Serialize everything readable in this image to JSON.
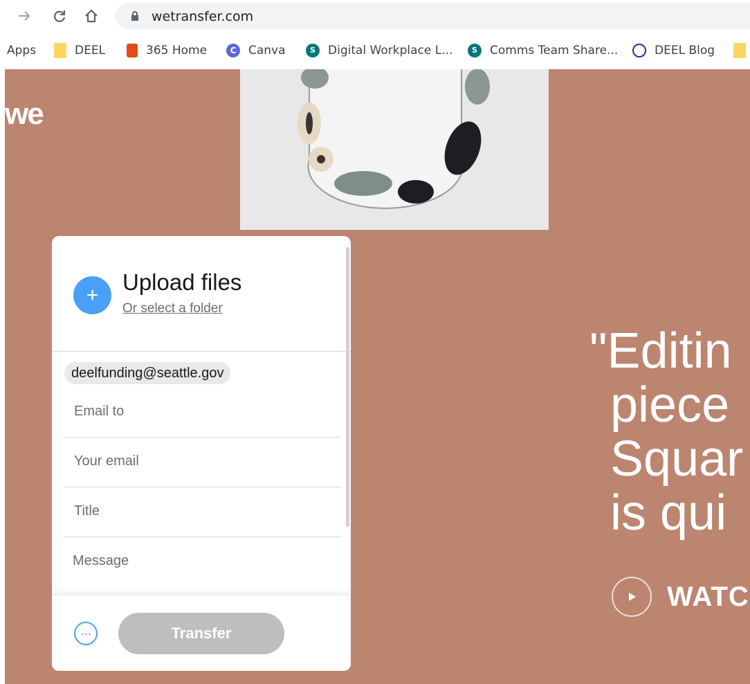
{
  "browser": {
    "url": "wetransfer.com",
    "bookmarks": [
      {
        "label": "Apps",
        "icon": "apps-grid-icon"
      },
      {
        "label": "DEEL",
        "icon": "folder-icon"
      },
      {
        "label": "365 Home",
        "icon": "office-365-icon"
      },
      {
        "label": "Canva",
        "icon": "canva-icon"
      },
      {
        "label": "Digital Workplace L...",
        "icon": "sharepoint-icon"
      },
      {
        "label": "Comms Team Share...",
        "icon": "sharepoint-icon"
      },
      {
        "label": "DEEL Blog",
        "icon": "globe-icon"
      }
    ]
  },
  "page": {
    "logo": "we",
    "background": "#bb8570",
    "quote_lines": [
      "\"Editin",
      "piece",
      "Squar",
      "is qui"
    ],
    "watch_label": "WATC"
  },
  "upload": {
    "title": "Upload files",
    "folder_link": "Or select a folder",
    "recipient_chip": "deelfunding@seattle.gov",
    "email_to_placeholder": "Email to",
    "your_email_placeholder": "Your email",
    "title_placeholder": "Title",
    "message_placeholder": "Message",
    "transfer_label": "Transfer",
    "accent": "#4aa0f7"
  }
}
